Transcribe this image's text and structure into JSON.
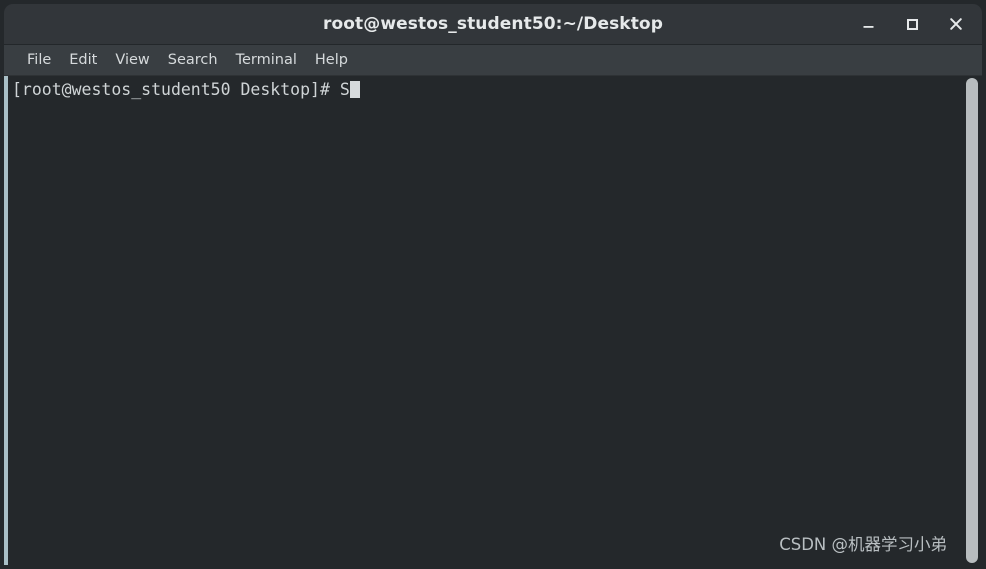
{
  "window": {
    "title": "root@westos_student50:~/Desktop",
    "controls": [
      {
        "name": "minimize-button",
        "icon": "minimize-icon",
        "label": "–"
      },
      {
        "name": "maximize-button",
        "icon": "maximize-icon",
        "label": "□"
      },
      {
        "name": "close-button",
        "icon": "close-icon",
        "label": "×"
      }
    ],
    "colors": {
      "titlebar_bg": "#32363a",
      "menubar_bg": "#393e42",
      "terminal_bg": "#24282b",
      "terminal_fg": "#cfd4d6",
      "left_border": "#a9bfc6",
      "scrollbar_thumb": "#b8bdbf",
      "cursor": "#d6dadc"
    }
  },
  "menubar": {
    "items": [
      {
        "label": "File"
      },
      {
        "label": "Edit"
      },
      {
        "label": "View"
      },
      {
        "label": "Search"
      },
      {
        "label": "Terminal"
      },
      {
        "label": "Help"
      }
    ]
  },
  "terminal": {
    "lines": [
      {
        "prompt": "[root@westos_student50 Desktop]# ",
        "input": "S",
        "cursor": true
      }
    ],
    "scrollbar": {
      "position": "full"
    }
  },
  "watermark": {
    "text": "CSDN @机器学习小弟"
  }
}
